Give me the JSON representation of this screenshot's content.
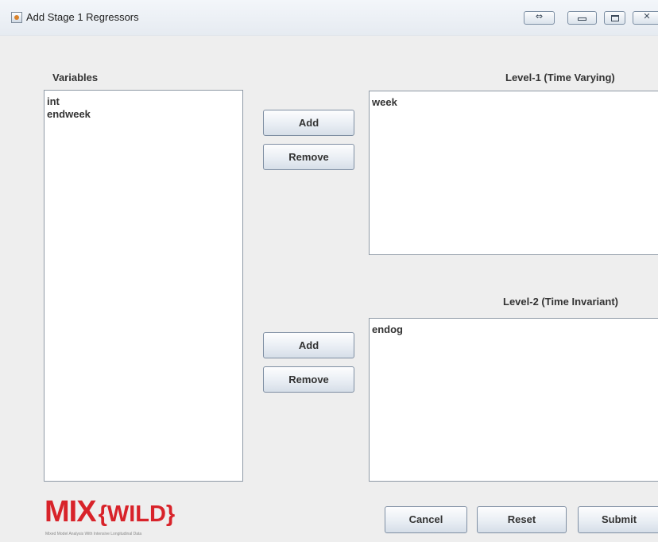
{
  "window": {
    "title": "Add Stage 1 Regressors"
  },
  "variables": {
    "label": "Variables",
    "items": [
      "int",
      "endweek"
    ]
  },
  "level1": {
    "label": "Level-1 (Time Varying)",
    "items": [
      "week"
    ],
    "add_label": "Add",
    "remove_label": "Remove"
  },
  "level2": {
    "label": "Level-2 (Time Invariant)",
    "items": [
      "endog"
    ],
    "add_label": "Add",
    "remove_label": "Remove"
  },
  "footer": {
    "cancel_label": "Cancel",
    "reset_label": "Reset",
    "submit_label": "Submit"
  },
  "logo": {
    "main": "MIX",
    "accent": "{WILD}",
    "tagline": "Mixed Model Analysis With Intensive Longitudinal Data",
    "color": "#d8232a"
  },
  "icons": {
    "app": "java-cup-icon",
    "swap": "double-arrow-icon",
    "minimize": "minimize-icon",
    "maximize": "maximize-icon",
    "close": "close-icon"
  }
}
